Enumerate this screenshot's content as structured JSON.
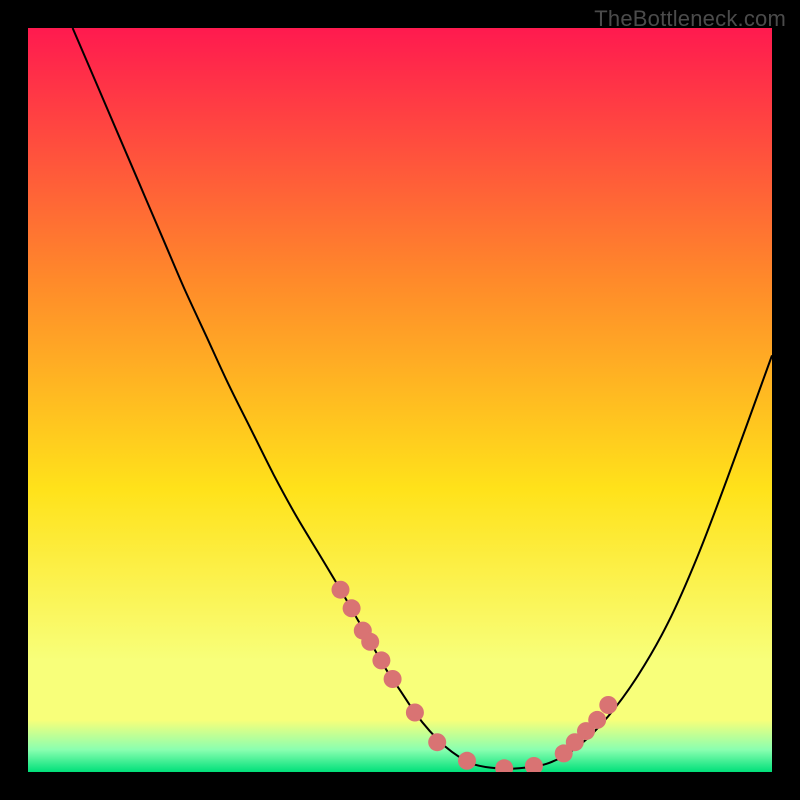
{
  "watermark": "TheBottleneck.com",
  "colors": {
    "frame": "#000000",
    "gradient_top": "#ff1a4f",
    "gradient_mid1": "#ff8a2a",
    "gradient_mid2": "#ffe21a",
    "gradient_bottom1": "#f8ff7a",
    "gradient_bottom2": "#8affb0",
    "gradient_bottom3": "#00e07a",
    "curve": "#000000",
    "marker": "#d97373"
  },
  "chart_data": {
    "type": "line",
    "title": "",
    "xlabel": "",
    "ylabel": "",
    "xlim": [
      0,
      100
    ],
    "ylim": [
      0,
      100
    ],
    "series": [
      {
        "name": "bottleneck-curve",
        "x": [
          6,
          9,
          12,
          15,
          18,
          21,
          24,
          27,
          30,
          33,
          36,
          39,
          42,
          44,
          46,
          48,
          50,
          52,
          54,
          56,
          58,
          60,
          63,
          66,
          70,
          74,
          78,
          82,
          86,
          90,
          94,
          100
        ],
        "y": [
          100,
          93,
          86,
          79,
          72,
          65,
          58.5,
          52,
          46,
          40,
          34.5,
          29.5,
          24.5,
          21,
          17.5,
          14,
          11,
          8,
          5.5,
          3.5,
          2,
          1,
          0.5,
          0.5,
          1.2,
          3.5,
          7.5,
          13,
          20,
          29,
          39.5,
          56
        ]
      }
    ],
    "markers": {
      "name": "highlight-points",
      "x": [
        42,
        43.5,
        45,
        46,
        47.5,
        49,
        52,
        55,
        59,
        64,
        68,
        72,
        73.5,
        75,
        76.5,
        78
      ],
      "y": [
        24.5,
        22,
        19,
        17.5,
        15,
        12.5,
        8,
        4,
        1.5,
        0.5,
        0.8,
        2.5,
        4,
        5.5,
        7,
        9
      ]
    }
  }
}
